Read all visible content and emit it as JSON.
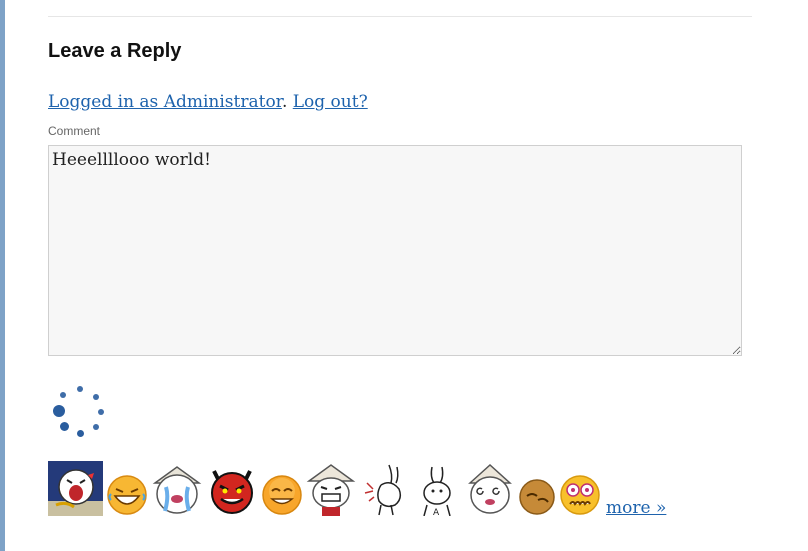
{
  "reply": {
    "heading": "Leave a Reply",
    "logged_in_link": "Logged in as Administrator",
    "separator": ". ",
    "logout_link": "Log out?",
    "comment_label": "Comment",
    "comment_text": "Heeellllooo world!"
  },
  "smileys": {
    "icons": [
      "angry-shout-icon",
      "laughing-face-icon",
      "crying-face-icon",
      "devil-face-icon",
      "grin-face-icon",
      "house-head-icon",
      "rabbit-sketch-icon",
      "rabbit-a-icon",
      "dizzy-face-icon",
      "brown-blob-icon",
      "shocked-face-icon"
    ],
    "more_label": "more »"
  },
  "colors": {
    "link": "#1e63ad",
    "spinner": "#2a5d9e",
    "left_rule": "#7ea2c7"
  }
}
